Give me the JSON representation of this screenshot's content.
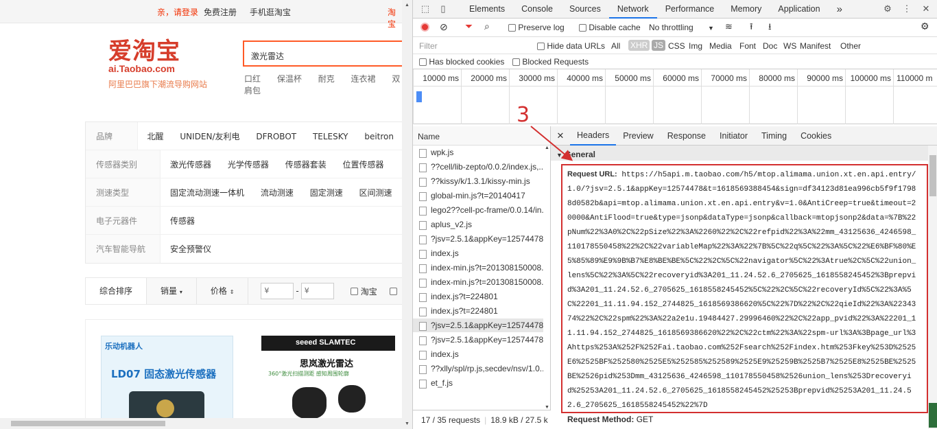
{
  "site": {
    "topbar": {
      "greeting": "亲，请登录",
      "register": "免费注册",
      "mobile": "手机逛淘宝",
      "right_link": "淘宝"
    },
    "logo": {
      "cn": "爱淘宝",
      "en": "ai.Taobao.com",
      "slogan": "阿里巴巴旗下潮流导购网站"
    },
    "search": {
      "value": "激光雷达"
    },
    "hotwords": [
      "口红",
      "保温杯",
      "耐克",
      "连衣裙",
      "双肩包"
    ],
    "filters": [
      {
        "label": "品牌",
        "values": [
          "北醒",
          "UNIDEN/友利电",
          "DFROBOT",
          "TELESKY",
          "beitron"
        ]
      },
      {
        "label": "传感器类别",
        "values": [
          "激光传感器",
          "光学传感器",
          "传感器套装",
          "位置传感器"
        ]
      },
      {
        "label": "测速类型",
        "values": [
          "固定流动测速一体机",
          "流动测速",
          "固定测速",
          "区间测速"
        ]
      },
      {
        "label": "电子元器件",
        "values": [
          "传感器"
        ]
      },
      {
        "label": "汽车智能导航",
        "values": [
          "安全预警仪"
        ]
      }
    ],
    "sort": {
      "comprehensive": "综合排序",
      "sales": "销量",
      "price": "价格",
      "price_min_placeholder": "¥",
      "price_max_placeholder": "¥",
      "dash": "-",
      "taobao_check": "淘宝"
    },
    "products": [
      {
        "brand": "乐动机器人",
        "title": "LD07 固态激光传感器"
      },
      {
        "brand": "seeed  SLAMTEC",
        "title": "思岚激光雷达",
        "subtitle": "360°激光扫描测距 感知周围轮廓"
      }
    ]
  },
  "devtools": {
    "tabs": [
      "Elements",
      "Console",
      "Sources",
      "Network",
      "Performance",
      "Memory",
      "Application"
    ],
    "active_tab": "Network",
    "more": "»",
    "toolbar": {
      "preserve_log": "Preserve log",
      "disable_cache": "Disable cache",
      "throttling": "No throttling"
    },
    "filter": {
      "placeholder": "Filter",
      "hide_data_urls": "Hide data URLs",
      "types": [
        "All",
        "XHR",
        "JS",
        "CSS",
        "Img",
        "Media",
        "Font",
        "Doc",
        "WS",
        "Manifest",
        "Other"
      ],
      "has_blocked_cookies": "Has blocked cookies",
      "blocked_requests": "Blocked Requests"
    },
    "timeline_ticks": [
      "10000 ms",
      "20000 ms",
      "30000 ms",
      "40000 ms",
      "50000 ms",
      "60000 ms",
      "70000 ms",
      "80000 ms",
      "90000 ms",
      "100000 ms",
      "110000 m"
    ],
    "list": {
      "header": "Name",
      "items": [
        "wpk.js",
        "??cell/lib-zepto/0.0.2/index.js,...",
        "??kissy/k/1.3.1/kissy-min.js",
        "global-min.js?t=20140417",
        "lego2??cell-pc-frame/0.0.14/in...",
        "aplus_v2.js",
        "?jsv=2.5.1&appKey=12574478...",
        "index.js",
        "index-min.js?t=201308150008...",
        "index-min.js?t=201308150008...",
        "index.js?t=224801",
        "index.js?t=224801",
        "?jsv=2.5.1&appKey=12574478...",
        "?jsv=2.5.1&appKey=12574478...",
        "index.js",
        "??xlly/spl/rp.js,secdev/nsv/1.0....",
        "et_f.js"
      ],
      "selected_index": 12,
      "status_requests": "17 / 35 requests",
      "status_size": "18.9 kB / 27.5 k"
    },
    "detail": {
      "tabs": [
        "Headers",
        "Preview",
        "Response",
        "Initiator",
        "Timing",
        "Cookies"
      ],
      "active_tab": "Headers",
      "section": "General",
      "request_url_label": "Request URL:",
      "request_url": "https://h5api.m.taobao.com/h5/mtop.alimama.union.xt.en.api.entry/1.0/?jsv=2.5.1&appKey=12574478&t=1618569388454&sign=df34123d81ea996cb5f9f17988d0582b&api=mtop.alimama.union.xt.en.api.entry&v=1.0&AntiCreep=true&timeout=20000&AntiFlood=true&type=jsonp&dataType=jsonp&callback=mtopjsonp2&data=%7B%22pNum%22%3A0%2C%22pSize%22%3A%2260%22%2C%22refpid%22%3A%22mm_43125636_4246598_110178550458%22%2C%22variableMap%22%3A%22%7B%5C%22q%5C%22%3A%5C%22%E6%BF%80%E5%85%89%E9%9B%B7%E8%BE%BE%5C%22%2C%5C%22navigator%5C%22%3Atrue%2C%5C%22union_lens%5C%22%3A%5C%22recoveryid%3A201_11.24.52.6_2705625_1618558245452%3Bprepvid%3A201_11.24.52.6_2705625_1618558245452%5C%22%2C%5C%22recoveryId%5C%22%3A%5C%22201_11.11.94.152_2744825_1618569386620%5C%22%7D%22%2C%22qieId%22%3A%2234374%22%2C%22spm%22%3A%22a2e1u.19484427.29996460%22%2C%22app_pvid%22%3A%22201_11.11.94.152_2744825_1618569386620%22%2C%22ctm%22%3A%22spm-url%3A%3Bpage_url%3Ahttps%253A%252F%252Fai.taobao.com%252Fsearch%252Findex.htm%253Fkey%253D%2525E6%2525BF%252580%2525E5%252585%252589%2525E9%25259B%2525B7%2525E8%2525BE%2525BE%2526pid%253Dmm_43125636_4246598_110178550458%2526union_lens%253Drecoveryid%25253A201_11.24.52.6_2705625_1618558245452%25253Bprepvid%25253A201_11.24.52.6_2705625_1618558245452%22%7D",
      "request_method_label": "Request Method:",
      "request_method": "GET"
    },
    "annotation": "3"
  },
  "colors": {
    "taobao_red": "#d63d2b",
    "search_orange": "#ff5a26",
    "highlight_red": "#d32f2f",
    "devtools_blue": "#1a73e8"
  }
}
